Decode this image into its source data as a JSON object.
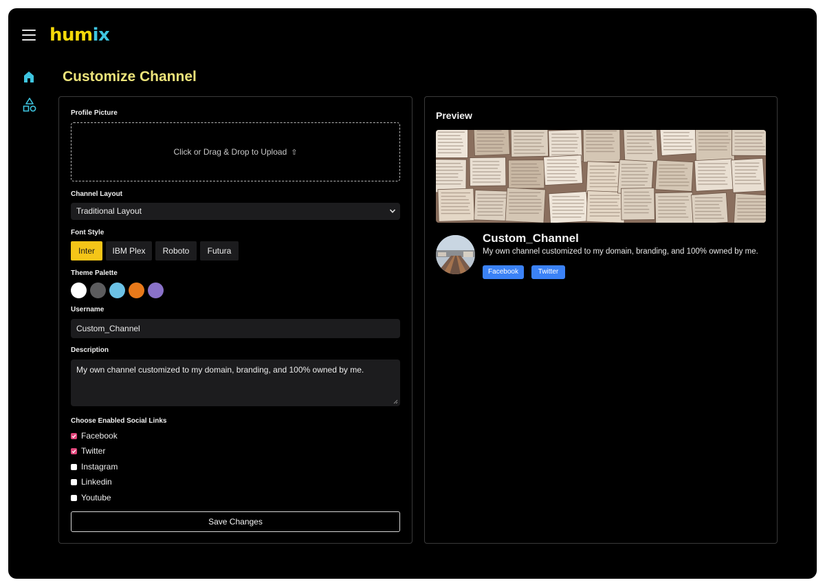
{
  "app": {
    "logo_part1": "hum",
    "logo_part2": "ix"
  },
  "page": {
    "title": "Customize Channel"
  },
  "form": {
    "profile_picture_label": "Profile Picture",
    "upload_text": "Click or Drag & Drop to Upload",
    "channel_layout_label": "Channel Layout",
    "channel_layout_value": "Traditional Layout",
    "font_style_label": "Font Style",
    "fonts": [
      {
        "label": "Inter",
        "active": true
      },
      {
        "label": "IBM Plex",
        "active": false
      },
      {
        "label": "Roboto",
        "active": false
      },
      {
        "label": "Futura",
        "active": false
      }
    ],
    "theme_palette_label": "Theme Palette",
    "palette": [
      "#ffffff",
      "#5c5c5e",
      "#6cc2e6",
      "#e8791a",
      "#8a72c9"
    ],
    "username_label": "Username",
    "username_value": "Custom_Channel",
    "description_label": "Description",
    "description_value": "My own channel customized to my domain, branding, and 100% owned by me.",
    "social_links_label": "Choose Enabled Social Links",
    "social_links": [
      {
        "label": "Facebook",
        "checked": true
      },
      {
        "label": "Twitter",
        "checked": true
      },
      {
        "label": "Instagram",
        "checked": false
      },
      {
        "label": "Linkedin",
        "checked": false
      },
      {
        "label": "Youtube",
        "checked": false
      }
    ],
    "save_label": "Save Changes"
  },
  "preview": {
    "title": "Preview",
    "channel_name": "Custom_Channel",
    "channel_description": "My own channel customized to my domain, branding, and 100% owned by me.",
    "social_buttons": [
      "Facebook",
      "Twitter"
    ]
  },
  "colors": {
    "accent_yellow": "#f5c518",
    "title_yellow": "#ece37a",
    "logo_cyan": "#3ec5e0",
    "checkbox_pink": "#e0457a",
    "social_blue": "#3b82f6"
  }
}
